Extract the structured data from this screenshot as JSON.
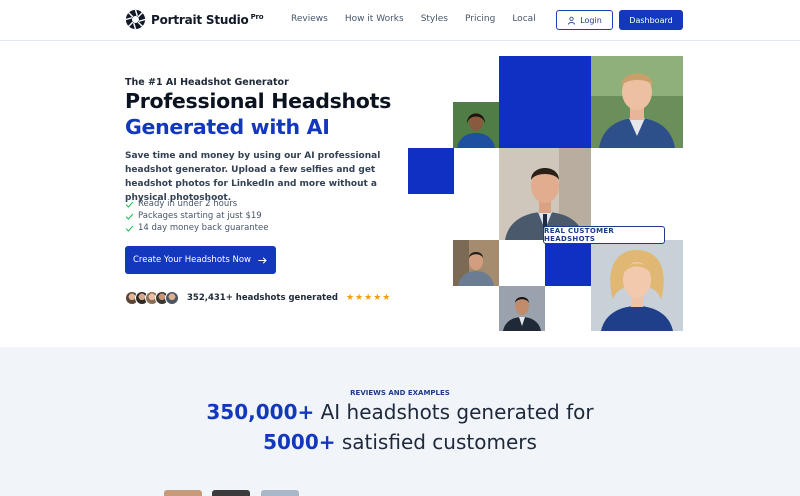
{
  "brand": {
    "name": "Portrait Studio",
    "sup": "Pro"
  },
  "nav": [
    "Reviews",
    "How it Works",
    "Styles",
    "Pricing",
    "Local"
  ],
  "header": {
    "login_label": "Login",
    "dashboard_label": "Dashboard"
  },
  "hero": {
    "eyebrow": "The #1 AI Headshot Generator",
    "title_line1": "Professional Headshots",
    "title_line2": "Generated with AI",
    "lead": "Save time and money by using our AI professional headshot generator. Upload a few selfies and get headshot photos for LinkedIn and more without a physical photoshoot.",
    "checks": [
      "Ready in under 2 hours",
      "Packages starting at just $19",
      "14 day money back guarantee"
    ],
    "cta_label": "Create Your Headshots Now",
    "proof_text": "352,431+ headshots generated",
    "stars": "★★★★★",
    "badge": "REAL CUSTOMER HEADSHOTS"
  },
  "reviews": {
    "eyebrow": "REVIEWS AND EXAMPLES",
    "line1_accent": "350,000+",
    "line1_rest": " AI headshots generated for",
    "line2_accent": "5000+",
    "line2_rest": " satisfied customers"
  },
  "colors": {
    "brand_blue": "#1338be",
    "tile_blue": "#1030c4",
    "check_green": "#22c55e",
    "star": "#f59e0b"
  },
  "icons": [
    "camera-aperture-icon",
    "user-icon",
    "check-icon",
    "arrow-right-icon",
    "star-icon"
  ]
}
